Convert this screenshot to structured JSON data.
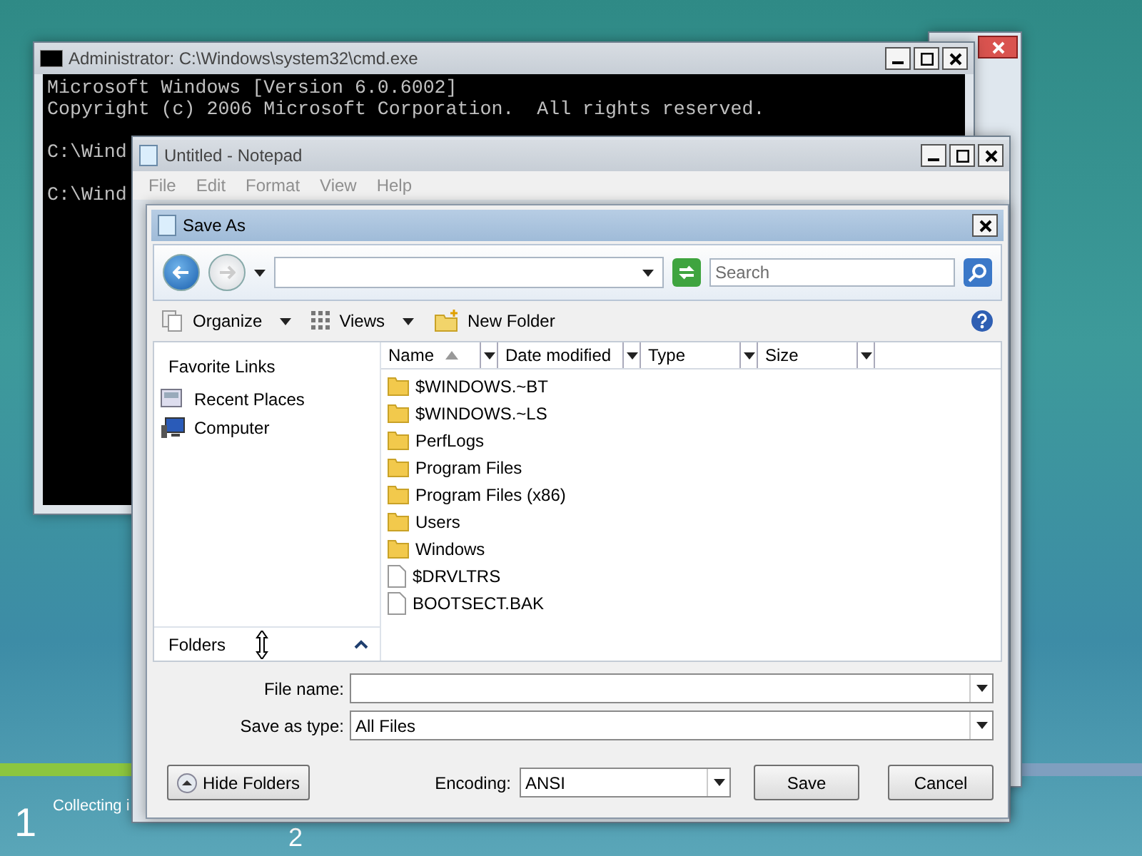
{
  "setup": {
    "progress": {
      "level": 0.13
    },
    "steps": [
      {
        "number": "1",
        "label": "Collecting i"
      },
      {
        "number": "2"
      }
    ]
  },
  "cmd": {
    "title": "Administrator: C:\\Windows\\system32\\cmd.exe",
    "lines": [
      "Microsoft Windows [Version 6.0.6002]",
      "Copyright (c) 2006 Microsoft Corporation.  All rights reserved."
    ],
    "prompts": [
      "C:\\Wind",
      "C:\\Wind"
    ]
  },
  "notepad": {
    "title": "Untitled - Notepad",
    "menu": [
      {
        "label": "File",
        "disabled": true
      },
      {
        "label": "Edit",
        "disabled": true
      },
      {
        "label": "Format",
        "disabled": true
      },
      {
        "label": "View",
        "disabled": true
      },
      {
        "label": "Help",
        "disabled": true
      }
    ]
  },
  "save_as": {
    "title": "Save As",
    "search": {
      "placeholder": "Search"
    },
    "toolbar": [
      {
        "label": "Organize",
        "kind": "organize",
        "dropdown": true
      },
      {
        "label": "Views",
        "kind": "views",
        "dropdown": true
      },
      {
        "label": "New Folder",
        "kind": "new-folder",
        "dropdown": false
      }
    ],
    "favorite_links": {
      "title": "Favorite Links",
      "items": [
        {
          "label": "Recent Places",
          "kind": "recent"
        },
        {
          "label": "Computer",
          "kind": "computer"
        }
      ]
    },
    "columns": [
      {
        "label": "Name",
        "sorted": true
      },
      {
        "label": "Date modified",
        "sorted": false
      },
      {
        "label": "Type",
        "sorted": false
      },
      {
        "label": "Size",
        "sorted": false
      }
    ],
    "files": [
      {
        "name": "$WINDOWS.~BT",
        "kind": "folder"
      },
      {
        "name": "$WINDOWS.~LS",
        "kind": "folder"
      },
      {
        "name": "PerfLogs",
        "kind": "folder"
      },
      {
        "name": "Program Files",
        "kind": "folder"
      },
      {
        "name": "Program Files (x86)",
        "kind": "folder"
      },
      {
        "name": "Users",
        "kind": "folder"
      },
      {
        "name": "Windows",
        "kind": "folder"
      },
      {
        "name": "$DRVLTRS",
        "kind": "file"
      },
      {
        "name": "BOOTSECT.BAK",
        "kind": "file"
      }
    ],
    "folders_bar": {
      "label": "Folders",
      "expanded": false
    },
    "fields": [
      {
        "label": "File name:"
      },
      {
        "label": "Save as type:",
        "value": "All Files"
      }
    ],
    "hide_folders": "Hide Folders",
    "encoding": {
      "label": "Encoding:",
      "value": "ANSI"
    },
    "buttons": [
      "Save",
      "Cancel"
    ]
  }
}
